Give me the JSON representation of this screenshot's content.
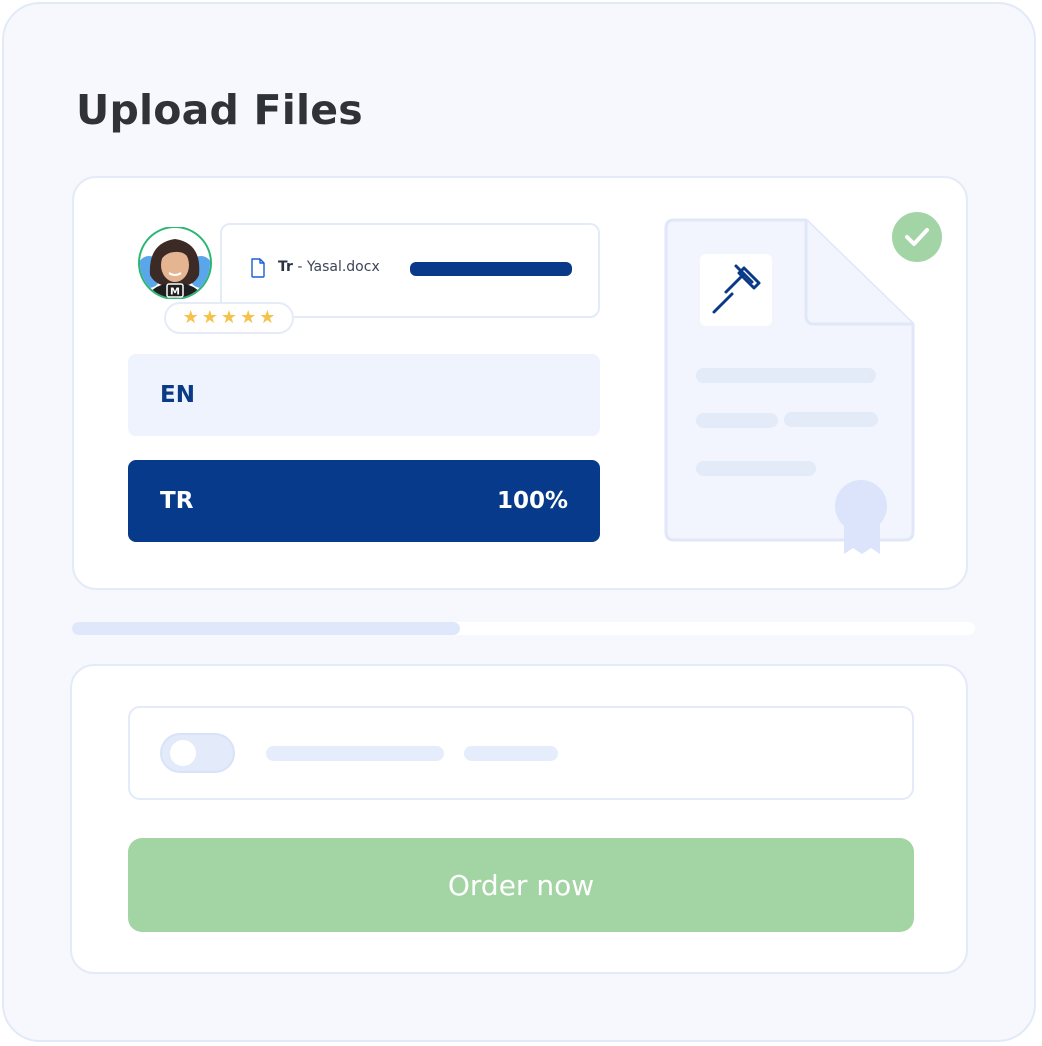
{
  "page": {
    "title": "Upload Files"
  },
  "file": {
    "prefix": "Tr",
    "name": " - Yasal.docx",
    "upload_progress": 1.0
  },
  "reviewer": {
    "rating": 5,
    "star_glyph": "★",
    "badge_letter": "M"
  },
  "languages": {
    "source": "EN",
    "target": "TR",
    "target_progress": "100%"
  },
  "document": {
    "icon": "gavel-icon",
    "status_icon": "checkmark-icon"
  },
  "progress": {
    "value": 0.43
  },
  "order": {
    "button_label": "Order now"
  },
  "colors": {
    "accent": "#073a8a",
    "success": "#a3d4a6",
    "light_accent": "#eef3fe",
    "placeholder": "#e5ecfb"
  }
}
